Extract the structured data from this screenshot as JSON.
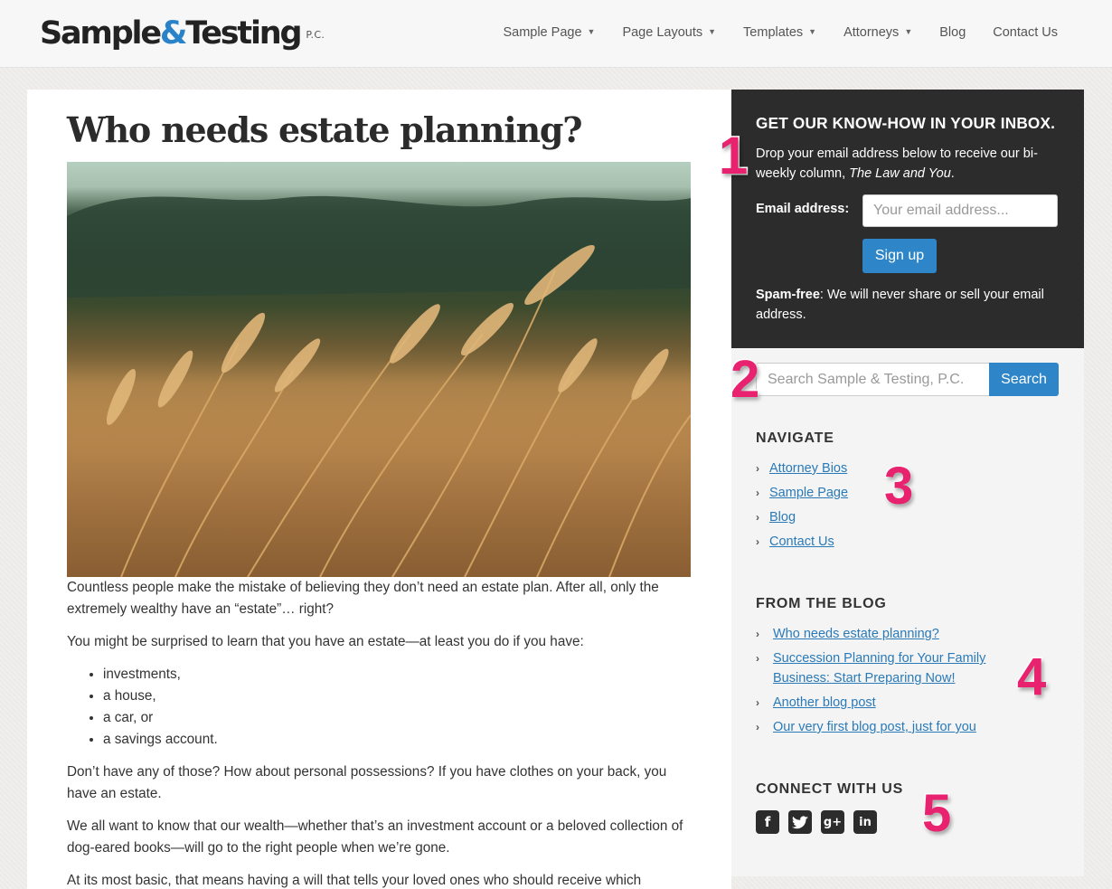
{
  "header": {
    "brand_main": "Sample",
    "brand_amp": "&",
    "brand_rest": "Testing",
    "brand_suffix": "P.C.",
    "nav": [
      {
        "label": "Sample Page",
        "dropdown": true
      },
      {
        "label": "Page Layouts",
        "dropdown": true
      },
      {
        "label": "Templates",
        "dropdown": true
      },
      {
        "label": "Attorneys",
        "dropdown": true
      },
      {
        "label": "Blog",
        "dropdown": false
      },
      {
        "label": "Contact Us",
        "dropdown": false
      }
    ]
  },
  "post": {
    "title": "Who needs estate planning?",
    "p1": "Countless people make the mistake of believing they don’t need an estate plan. After all, only the extremely wealthy have an “estate”… right?",
    "p2": "You might be surprised to learn that you have an estate—at least you do if you have:",
    "list": [
      "investments,",
      "a house,",
      "a car, or",
      "a savings account."
    ],
    "p3": "Don’t have any of those? How about personal possessions? If you have clothes on your back, you have an estate.",
    "p4": "We all want to know that our wealth—whether that’s an investment account or a beloved collection of dog-eared books—will go to the right people when we’re gone.",
    "p5": "At its most basic, that means having a will that tells your loved ones who should receive which"
  },
  "signup": {
    "heading": "GET OUR KNOW-HOW IN YOUR INBOX.",
    "desc_before": "Drop your email address below to receive our bi-weekly column, ",
    "desc_italic": "The Law and You",
    "desc_after": ".",
    "email_label": "Email address:",
    "email_placeholder": "Your email address...",
    "button": "Sign up",
    "spam_bold": "Spam-free",
    "spam_text": ": We will never share or sell your email address."
  },
  "search": {
    "placeholder": "Search Sample & Testing, P.C.",
    "button": "Search"
  },
  "navigate": {
    "title": "NAVIGATE",
    "items": [
      "Attorney Bios",
      "Sample Page",
      "Blog",
      "Contact Us"
    ]
  },
  "blog": {
    "title": "FROM THE BLOG",
    "items": [
      "Who needs estate planning?",
      "Succession Planning for Your Family Business: Start Preparing Now!",
      "Another blog post",
      "Our very first blog post, just for you"
    ]
  },
  "connect": {
    "title": "CONNECT WITH US",
    "icons": [
      "facebook-icon",
      "twitter-icon",
      "google-plus-icon",
      "linkedin-icon"
    ]
  },
  "callouts": [
    "1",
    "2",
    "3",
    "4",
    "5"
  ],
  "colors": {
    "accent": "#2e86c9",
    "link": "#2a7ab8",
    "callout": "#e8226e",
    "dark_panel": "#2c2c2c"
  }
}
